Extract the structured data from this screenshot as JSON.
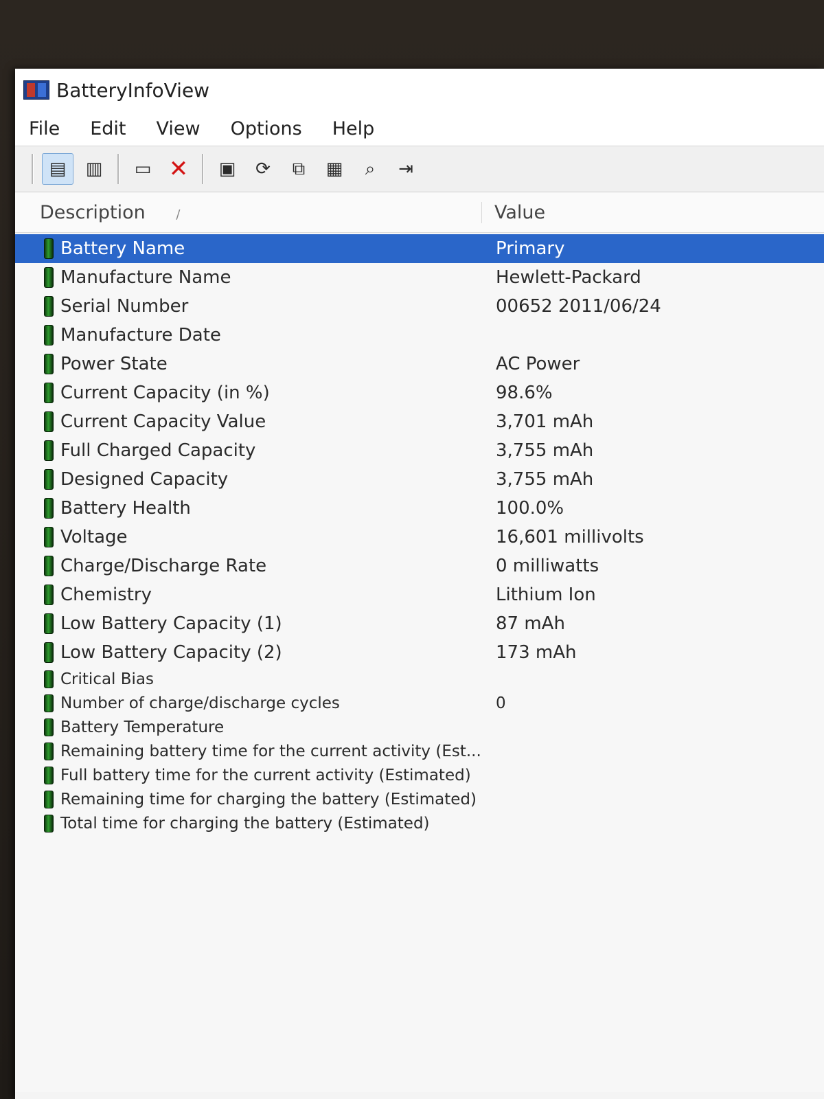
{
  "window": {
    "title": "BatteryInfoView"
  },
  "menu": [
    "File",
    "Edit",
    "View",
    "Options",
    "Help"
  ],
  "toolbar": {
    "icons": [
      "properties-icon",
      "clipboard-icon",
      "window-icon",
      "delete-icon",
      "save-icon",
      "refresh-icon",
      "copy-icon",
      "options-icon",
      "find-icon",
      "exit-icon"
    ]
  },
  "list": {
    "headers": {
      "description": "Description",
      "value": "Value",
      "sort_indicator": "/"
    },
    "rows": [
      {
        "label": "Battery Name",
        "value": "Primary"
      },
      {
        "label": "Manufacture Name",
        "value": "Hewlett-Packard"
      },
      {
        "label": "Serial Number",
        "value": "00652 2011/06/24"
      },
      {
        "label": "Manufacture Date",
        "value": ""
      },
      {
        "label": "Power State",
        "value": "AC Power"
      },
      {
        "label": "Current Capacity (in %)",
        "value": "98.6%"
      },
      {
        "label": "Current Capacity Value",
        "value": "3,701 mAh"
      },
      {
        "label": "Full Charged Capacity",
        "value": "3,755 mAh"
      },
      {
        "label": "Designed Capacity",
        "value": "3,755 mAh"
      },
      {
        "label": "Battery Health",
        "value": "100.0%"
      },
      {
        "label": "Voltage",
        "value": "16,601 millivolts"
      },
      {
        "label": "Charge/Discharge Rate",
        "value": "0 milliwatts"
      },
      {
        "label": "Chemistry",
        "value": "Lithium Ion"
      },
      {
        "label": "Low Battery Capacity (1)",
        "value": "87 mAh"
      },
      {
        "label": "Low Battery Capacity (2)",
        "value": "173 mAh"
      },
      {
        "label": "Critical Bias",
        "value": ""
      },
      {
        "label": "Number of charge/discharge cycles",
        "value": "0"
      },
      {
        "label": "Battery Temperature",
        "value": ""
      },
      {
        "label": "Remaining battery time for the current activity (Est...",
        "value": ""
      },
      {
        "label": "Full battery time for the current activity (Estimated)",
        "value": ""
      },
      {
        "label": "Remaining time for charging the battery (Estimated)",
        "value": ""
      },
      {
        "label": "Total  time for charging the battery (Estimated)",
        "value": ""
      }
    ]
  }
}
